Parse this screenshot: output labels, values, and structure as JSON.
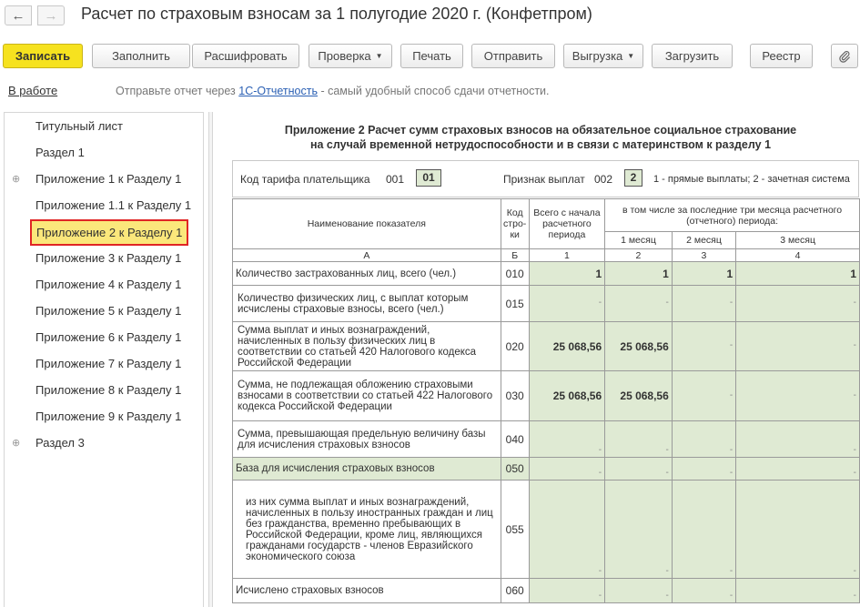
{
  "window": {
    "title": "Расчет по страховым взносам за 1 полугодие 2020 г. (Конфетпром)"
  },
  "toolbar": {
    "buttons": [
      {
        "label": "Записать"
      },
      {
        "label": "Заполнить"
      },
      {
        "label": "Расшифровать"
      },
      {
        "label": "Проверка"
      },
      {
        "label": "Печать"
      },
      {
        "label": "Отправить"
      },
      {
        "label": "Выгрузка"
      },
      {
        "label": "Загрузить"
      },
      {
        "label": "Реестр"
      }
    ]
  },
  "status": {
    "state": "В работе",
    "hint_before": "Отправьте отчет через ",
    "hint_link": "1С-Отчетность",
    "hint_after": " - самый удобный способ сдачи отчетности."
  },
  "sidebar": {
    "items": [
      {
        "label": "Титульный лист"
      },
      {
        "label": "Раздел 1"
      },
      {
        "label": "Приложение 1 к Разделу 1"
      },
      {
        "label": "Приложение 1.1 к Разделу 1"
      },
      {
        "label": "Приложение 2 к Разделу 1"
      },
      {
        "label": "Приложение 3 к Разделу 1"
      },
      {
        "label": "Приложение 4 к Разделу 1"
      },
      {
        "label": "Приложение 5 к Разделу 1"
      },
      {
        "label": "Приложение 6 к Разделу 1"
      },
      {
        "label": "Приложение 7 к Разделу 1"
      },
      {
        "label": "Приложение 8 к Разделу 1"
      },
      {
        "label": "Приложение 9 к Разделу 1"
      },
      {
        "label": "Раздел 3"
      }
    ],
    "selected": "Приложение 2 к Разделу 1"
  },
  "form": {
    "title_line1": "Приложение 2 Расчет сумм страховых взносов на обязательное социальное страхование",
    "title_line2": "на случай временной нетрудоспособности и в связи с материнством к разделу 1",
    "tariff_label": "Код тарифа плательщика",
    "tariff_field_code": "001",
    "tariff_value": "01",
    "payment_label": "Признак выплат",
    "payment_field_code": "002",
    "payment_value": "2",
    "payment_hint": "1 - прямые выплаты; 2 - зачетная система"
  },
  "table": {
    "headers": {
      "name": "Наименование показателя",
      "code": "Код стро-ки",
      "total": "Всего с начала расчетного периода",
      "last3": "в том числе за последние три месяца расчетного (отчетного) периода:",
      "m1": "1 месяц",
      "m2": "2 месяц",
      "m3": "3 месяц"
    },
    "col_labels": [
      "А",
      "Б",
      "1",
      "2",
      "3",
      "4"
    ],
    "rows": [
      {
        "name": "Количество застрахованных лиц, всего (чел.)",
        "code": "010",
        "values": [
          "1",
          "1",
          "1",
          "1"
        ]
      },
      {
        "name": "Количество физических лиц, с выплат которым исчислены страховые взносы, всего (чел.)",
        "code": "015",
        "values": [
          "-",
          "-",
          "-",
          "-"
        ]
      },
      {
        "name": "Сумма выплат и иных вознаграждений, начисленных в пользу физических лиц в соответствии со статьей 420 Налогового кодекса Российской Федерации",
        "code": "020",
        "values": [
          "25 068,56",
          "25 068,56",
          "-",
          "-"
        ]
      },
      {
        "name": "Сумма, не подлежащая обложению страховыми взносами в соответствии со статьей 422 Налогового кодекса Российской Федерации",
        "code": "030",
        "values": [
          "25 068,56",
          "25 068,56",
          "-",
          "-"
        ]
      },
      {
        "name": "Сумма, превышающая предельную величину базы для исчисления страховых взносов",
        "code": "040",
        "values": [
          "-",
          "-",
          "-",
          "-"
        ]
      },
      {
        "name": "База для исчисления страховых взносов",
        "code": "050",
        "values": [
          "-",
          "-",
          "-",
          "-"
        ]
      },
      {
        "name": "из них сумма выплат и иных вознаграждений, начисленных в пользу иностранных граждан и лиц без гражданства, временно пребывающих в Российской Федерации, кроме лиц, являющихся гражданами государств - членов Евразийского экономического союза",
        "code": "055",
        "values": [
          "-",
          "-",
          "-",
          "-"
        ]
      },
      {
        "name": "Исчислено страховых взносов",
        "code": "060",
        "values": [
          "-",
          "-",
          "-",
          "-"
        ]
      }
    ]
  },
  "colors": {
    "primary_button": "#f6e21f",
    "field_fill": "#dfead3",
    "selection_fill": "#fbe77b",
    "selection_border": "#e02525",
    "link": "#2b60b4"
  }
}
